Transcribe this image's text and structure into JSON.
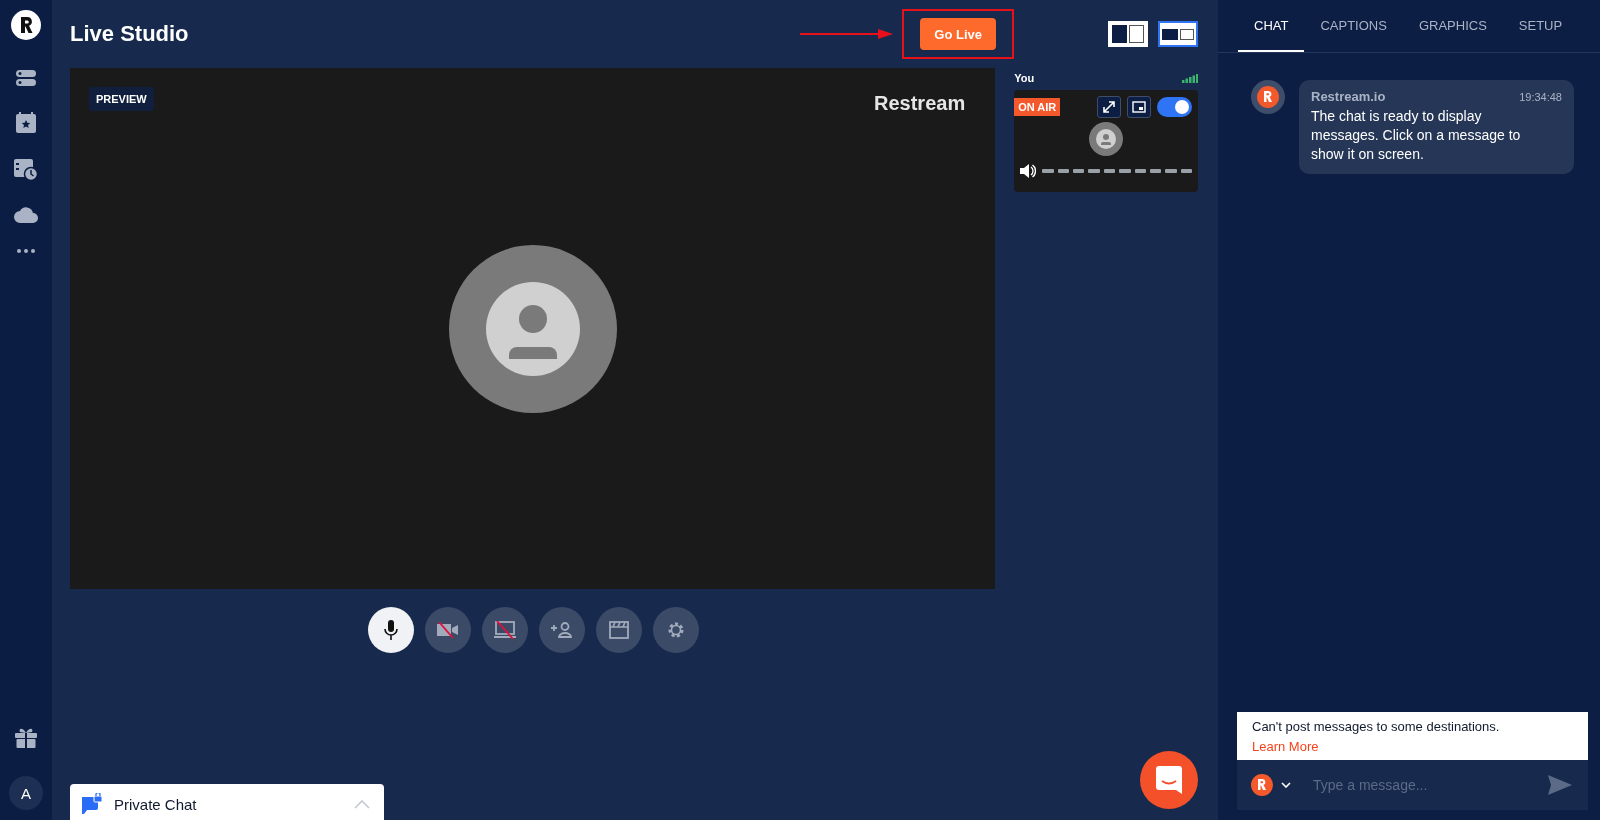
{
  "header": {
    "title": "Live Studio",
    "go_live": "Go Live",
    "layouts": [
      {
        "selected": false
      },
      {
        "selected": true
      }
    ]
  },
  "preview": {
    "badge": "PREVIEW",
    "watermark": "Restream"
  },
  "participant": {
    "name": "You",
    "status": "ON AIR",
    "enabled": true
  },
  "controls": [
    {
      "kind": "mic",
      "on": true
    },
    {
      "kind": "camera",
      "on": false
    },
    {
      "kind": "screen",
      "on": false
    },
    {
      "kind": "invite",
      "on": false
    },
    {
      "kind": "scenes",
      "on": false
    },
    {
      "kind": "settings",
      "on": false
    }
  ],
  "rail": {
    "avatar": "A"
  },
  "private_chat": {
    "label": "Private Chat"
  },
  "chat": {
    "tabs": [
      {
        "label": "CHAT",
        "selected": true
      },
      {
        "label": "CAPTIONS",
        "selected": false
      },
      {
        "label": "GRAPHICS",
        "selected": false
      },
      {
        "label": "SETUP",
        "selected": false
      }
    ],
    "messages": [
      {
        "author": "Restream.io",
        "time": "19:34:48",
        "text": "The chat is ready to display messages. Click on a message to show it on screen."
      }
    ],
    "notice": {
      "text": "Can't post messages to some destinations.",
      "link": "Learn More"
    },
    "input": {
      "placeholder": "Type a message..."
    }
  }
}
